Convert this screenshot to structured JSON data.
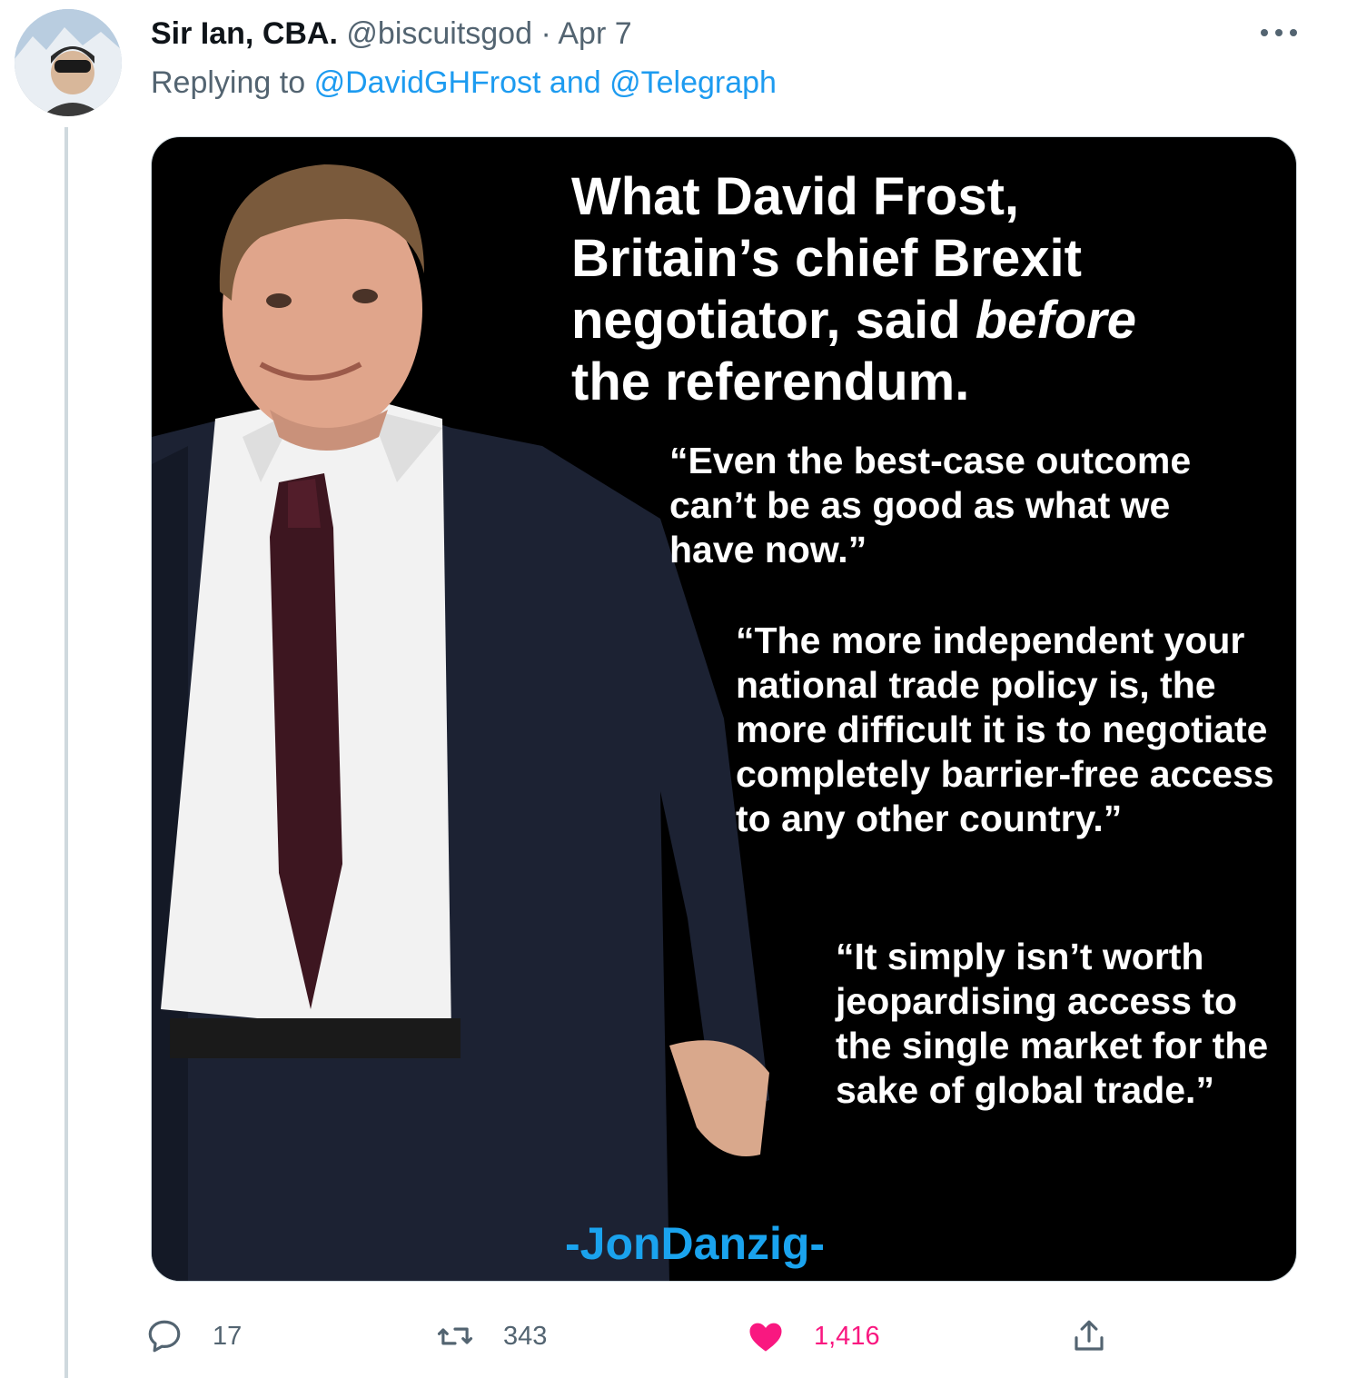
{
  "tweet": {
    "display_name": "Sir Ian, CBA.",
    "handle": "@biscuitsgod",
    "separator": "·",
    "date": "Apr 7",
    "replying_prefix": "Replying to",
    "reply_to_1": "@DavidGHFrost",
    "reply_and": "and",
    "reply_to_2": "@Telegraph"
  },
  "image": {
    "headline_line1": "What David Frost,",
    "headline_line2": "Britain’s chief Brexit",
    "headline_line3a": "negotiator, said ",
    "headline_line3b": "before",
    "headline_line4": "the referendum.",
    "quote1": "“Even the best-case outcome can’t be as good as what we have now.”",
    "quote2": "“The more independent your national trade policy is, the more difficult it is to negotiate completely barrier-free access to any other country.”",
    "quote3": "“It simply isn’t worth jeopardising access to the single market for the sake of global trade.”",
    "credit": "-JonDanzig-"
  },
  "actions": {
    "replies": "17",
    "retweets": "343",
    "likes": "1,416"
  },
  "colors": {
    "accent": "#1d9bf0",
    "like": "#f91880",
    "muted": "#536471"
  },
  "icons": [
    "reply-icon",
    "retweet-icon",
    "heart-icon",
    "share-icon",
    "more-icon"
  ]
}
